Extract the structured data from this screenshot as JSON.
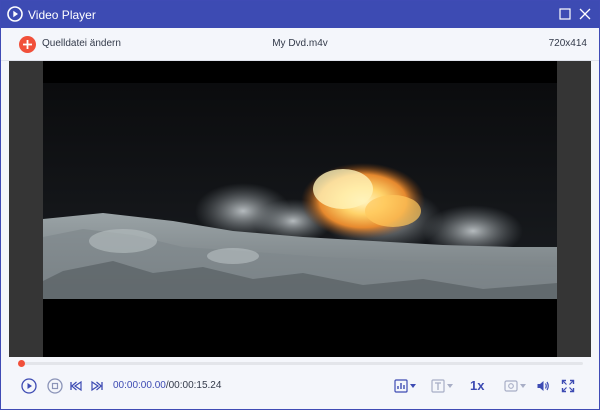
{
  "window": {
    "title": "Video Player",
    "icons": {
      "app": "play-circle-icon",
      "maximize": "maximize-icon",
      "close": "close-icon"
    }
  },
  "toolbar": {
    "add_source_label": "Quelldatei ändern",
    "file_name": "My Dvd.m4v",
    "resolution": "720x414",
    "add_icon": "plus-icon"
  },
  "playback": {
    "progress_fraction": 0.002,
    "current_time": "00:00:00.00",
    "total_time": "/00:00:15.24",
    "speed": "1x"
  },
  "controls": {
    "icons": [
      "play-icon",
      "stop-icon",
      "skip-back-icon",
      "skip-forward-icon",
      "equalizer-icon",
      "text-subtitle-icon",
      "snapshot-icon",
      "volume-icon",
      "fullscreen-icon"
    ]
  },
  "colors": {
    "accent": "#3d4bb3",
    "record": "#f1503a",
    "video_bg": "#353535"
  }
}
